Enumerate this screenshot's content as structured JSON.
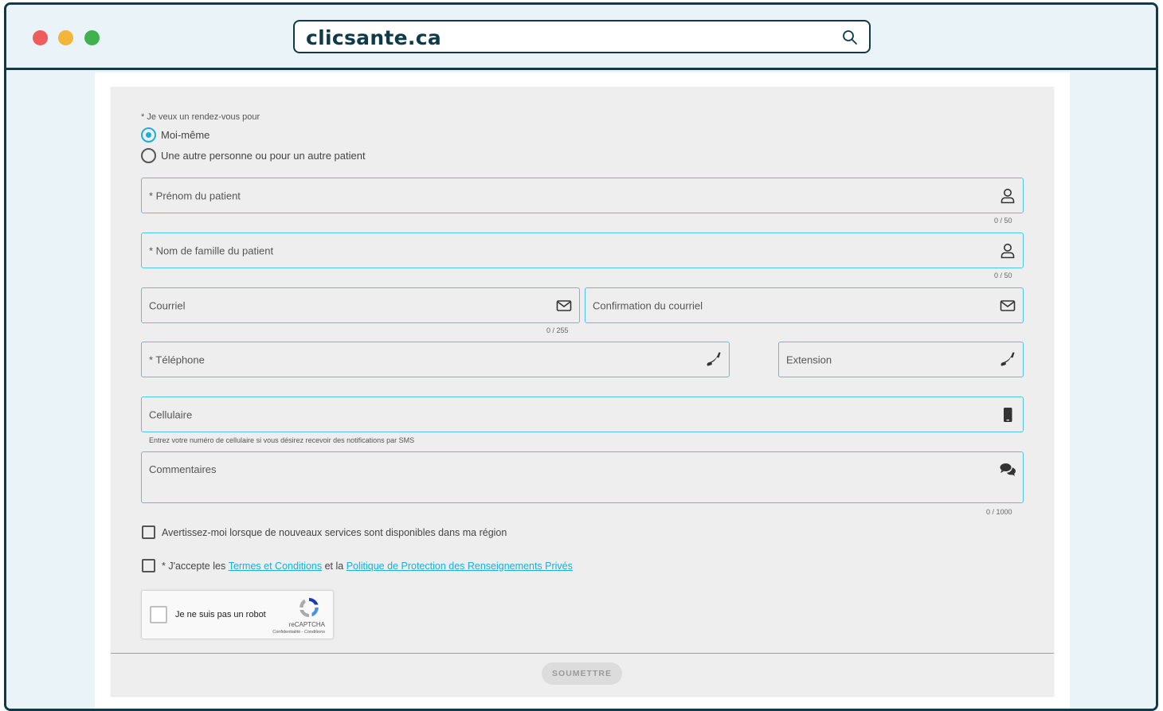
{
  "browser": {
    "url": "clicsante.ca",
    "window_controls": [
      "close",
      "minimize",
      "maximize"
    ]
  },
  "form": {
    "appointment_for_label": "* Je veux un rendez-vous pour",
    "options": [
      {
        "label": "Moi-même",
        "selected": true
      },
      {
        "label": "Une autre personne ou pour un autre patient",
        "selected": false
      }
    ],
    "first_name": {
      "label": "* Prénom du patient",
      "icon": "person-icon",
      "counter": "0 / 50"
    },
    "last_name": {
      "label": "* Nom de famille du patient",
      "icon": "person-icon",
      "counter": "0 / 50"
    },
    "email": {
      "label": "Courriel",
      "icon": "envelope-icon",
      "counter": "0 / 255"
    },
    "email_confirm": {
      "label": "Confirmation du courriel",
      "icon": "envelope-icon"
    },
    "phone": {
      "label": "* Téléphone",
      "icon": "phone-icon"
    },
    "extension": {
      "label": "Extension",
      "icon": "phone-icon"
    },
    "cell": {
      "label": "Cellulaire",
      "icon": "mobile-icon",
      "hint": "Entrez votre numéro de cellulaire si vous désirez recevoir des notifications par SMS"
    },
    "comments": {
      "label": "Commentaires",
      "icon": "chat-icon",
      "counter": "0 / 1000"
    },
    "notify_checkbox": {
      "label": "Avertissez-moi lorsque de nouveaux services sont disponibles dans ma région",
      "checked": false
    },
    "terms": {
      "prefix": "* J'accepte les ",
      "terms_link": "Termes et Conditions",
      "middle": " et la ",
      "privacy_link": "Politique de Protection des Renseignements Privés",
      "checked": false
    },
    "recaptcha": {
      "label": "Je ne suis pas un robot",
      "brand": "reCAPTCHA",
      "terms": "Confidentialité - Conditions"
    },
    "submit_label": "SOUMETTRE"
  },
  "colors": {
    "accent": "#1ab0d8",
    "field_border": "#4fc3e8",
    "frame": "#0f3a4a",
    "card_bg": "#eeeeee"
  }
}
